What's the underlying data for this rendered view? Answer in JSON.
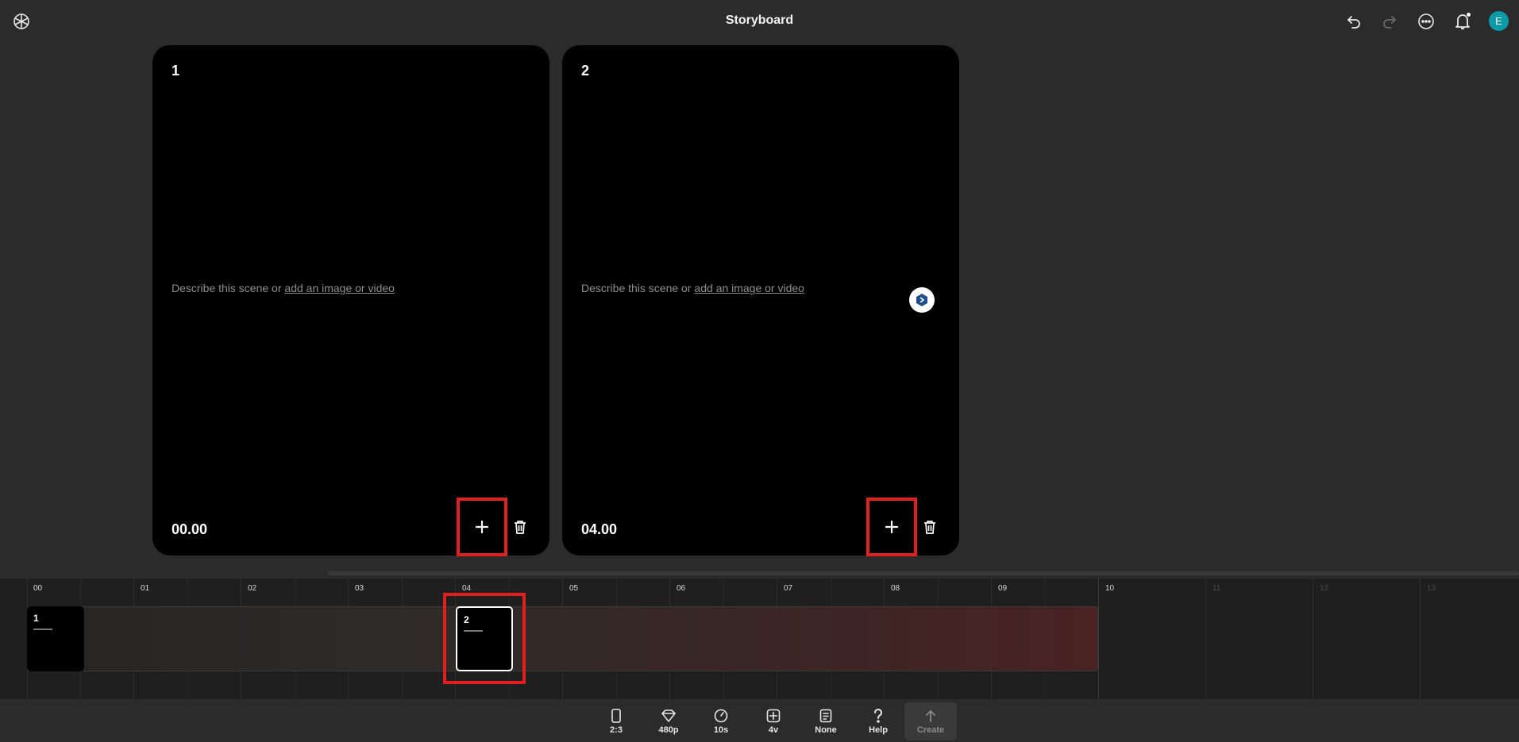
{
  "header": {
    "title": "Storyboard",
    "icons": [
      "logo-icon",
      "undo-icon",
      "redo-icon",
      "more-icon",
      "bell-icon"
    ],
    "avatar_initial": "E"
  },
  "scenes": [
    {
      "number": "1",
      "prompt_prefix": "Describe this scene or ",
      "prompt_link": "add an image or video",
      "time": "00.00"
    },
    {
      "number": "2",
      "prompt_prefix": "Describe this scene or ",
      "prompt_link": "add an image or video",
      "time": "04.00"
    }
  ],
  "timeline": {
    "ticks": [
      "00",
      "01",
      "02",
      "03",
      "04",
      "05",
      "06",
      "07",
      "08",
      "09",
      "10",
      "11",
      "12",
      "13"
    ],
    "clips": [
      {
        "label": "1"
      },
      {
        "label": "2"
      }
    ]
  },
  "toolbar": {
    "items": [
      {
        "icon": "phone-icon",
        "label": "2:3"
      },
      {
        "icon": "diamond-icon",
        "label": "480p"
      },
      {
        "icon": "gauge-icon",
        "label": "10s"
      },
      {
        "icon": "grid-icon",
        "label": "4v"
      },
      {
        "icon": "preset-icon",
        "label": "None"
      },
      {
        "icon": "question-icon",
        "label": "Help"
      },
      {
        "icon": "arrow-up-icon",
        "label": "Create"
      }
    ]
  },
  "colors": {
    "accent_highlight": "#e01f1f",
    "avatar": "#0a9aa8"
  }
}
